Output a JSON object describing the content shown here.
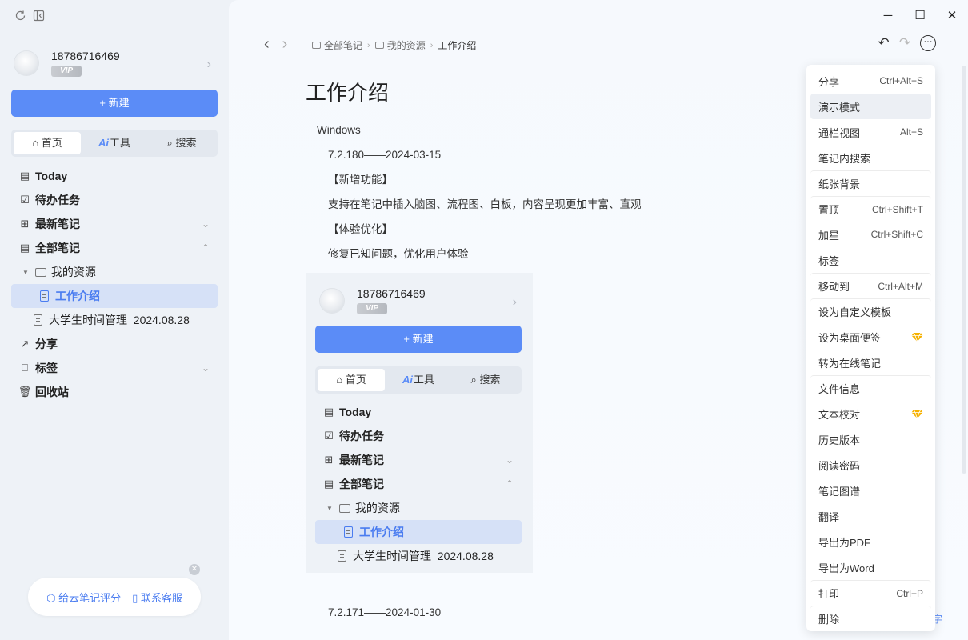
{
  "sidebar": {
    "user": {
      "name": "18786716469",
      "badge": "VIP"
    },
    "new_button": "+ 新建",
    "tabs": [
      {
        "icon": "home-icon",
        "label": "首页",
        "active": true
      },
      {
        "icon": "ai-icon",
        "prefix": "Ai",
        "label": "工具",
        "active": false
      },
      {
        "icon": "search-icon",
        "label": "搜索",
        "active": false
      }
    ],
    "nav": {
      "today": "Today",
      "todo": "待办任务",
      "recent": "最新笔记",
      "all_notes": "全部笔记",
      "my_resources": "我的资源",
      "work_intro": "工作介绍",
      "student_time": "大学生时间管理_2024.08.28",
      "share": "分享",
      "tags": "标签",
      "trash": "回收站"
    },
    "feedback": {
      "rate": "给云笔记评分",
      "support": "联系客服"
    }
  },
  "toolbar": {
    "breadcrumb": [
      "全部笔记",
      "我的资源",
      "工作介绍"
    ]
  },
  "document": {
    "title": "工作介绍",
    "paragraphs": [
      {
        "text": "Windows",
        "indent": false
      },
      {
        "text": "7.2.180——2024-03-15",
        "indent": true
      },
      {
        "text": "【新增功能】",
        "indent": true
      },
      {
        "text": "支持在笔记中插入脑图、流程图、白板，内容呈现更加丰富、直观",
        "indent": true
      },
      {
        "text": "【体验优化】",
        "indent": true
      },
      {
        "text": "修复已知问题，优化用户体验",
        "indent": true
      }
    ],
    "later_paragraph": "7.2.171——2024-01-30",
    "peek_text": "字"
  },
  "context_menu": {
    "items": [
      {
        "label": "分享",
        "shortcut": "Ctrl+Alt+S"
      },
      {
        "label": "演示模式",
        "shortcut": "",
        "hover": true
      },
      {
        "label": "通栏视图",
        "shortcut": "Alt+S"
      },
      {
        "label": "笔记内搜索",
        "shortcut": ""
      },
      {
        "label": "纸张背景",
        "shortcut": "",
        "divider": true
      },
      {
        "label": "置顶",
        "shortcut": "Ctrl+Shift+T",
        "divider": true
      },
      {
        "label": "加星",
        "shortcut": "Ctrl+Shift+C"
      },
      {
        "label": "标签",
        "shortcut": ""
      },
      {
        "label": "移动到",
        "shortcut": "Ctrl+Alt+M",
        "divider": true
      },
      {
        "label": "设为自定义模板",
        "shortcut": "",
        "divider": true
      },
      {
        "label": "设为桌面便签",
        "shortcut": "",
        "premium": true
      },
      {
        "label": "转为在线笔记",
        "shortcut": ""
      },
      {
        "label": "文件信息",
        "shortcut": "",
        "divider": true
      },
      {
        "label": "文本校对",
        "shortcut": "",
        "premium": true
      },
      {
        "label": "历史版本",
        "shortcut": ""
      },
      {
        "label": "阅读密码",
        "shortcut": ""
      },
      {
        "label": "笔记图谱",
        "shortcut": ""
      },
      {
        "label": "翻译",
        "shortcut": ""
      },
      {
        "label": "导出为PDF",
        "shortcut": ""
      },
      {
        "label": "导出为Word",
        "shortcut": ""
      },
      {
        "label": "打印",
        "shortcut": "Ctrl+P",
        "divider": true
      },
      {
        "label": "删除",
        "shortcut": "",
        "divider": true
      }
    ]
  },
  "colors": {
    "accent": "#5b8cf7",
    "selected_bg": "#d6e1f7",
    "premium": "#f5b100"
  }
}
